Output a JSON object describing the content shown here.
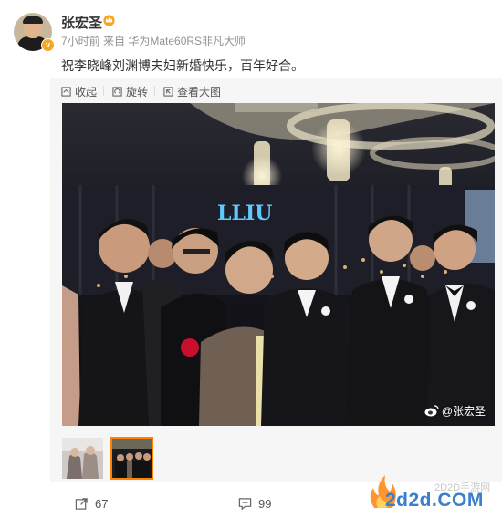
{
  "post": {
    "username": "张宏圣",
    "meta": "7小时前  来自 华为Mate60RS非凡大师",
    "content": "祝李晓峰刘渊博夫妇新婚快乐，百年好合。"
  },
  "toolbar": {
    "collapse_label": "收起",
    "rotate_label": "旋转",
    "view_large_label": "查看大图"
  },
  "photo": {
    "watermark": "@张宏圣",
    "sign_text": "LLIU"
  },
  "footer": {
    "repost_count": "67",
    "comment_count": "99"
  },
  "site": {
    "name_cn": "2D2D手游网",
    "domain": "2d2d.COM"
  },
  "colors": {
    "accent": "#ff8200",
    "verified": "#f5a623",
    "toolbar_bg": "#f6f6f6"
  }
}
